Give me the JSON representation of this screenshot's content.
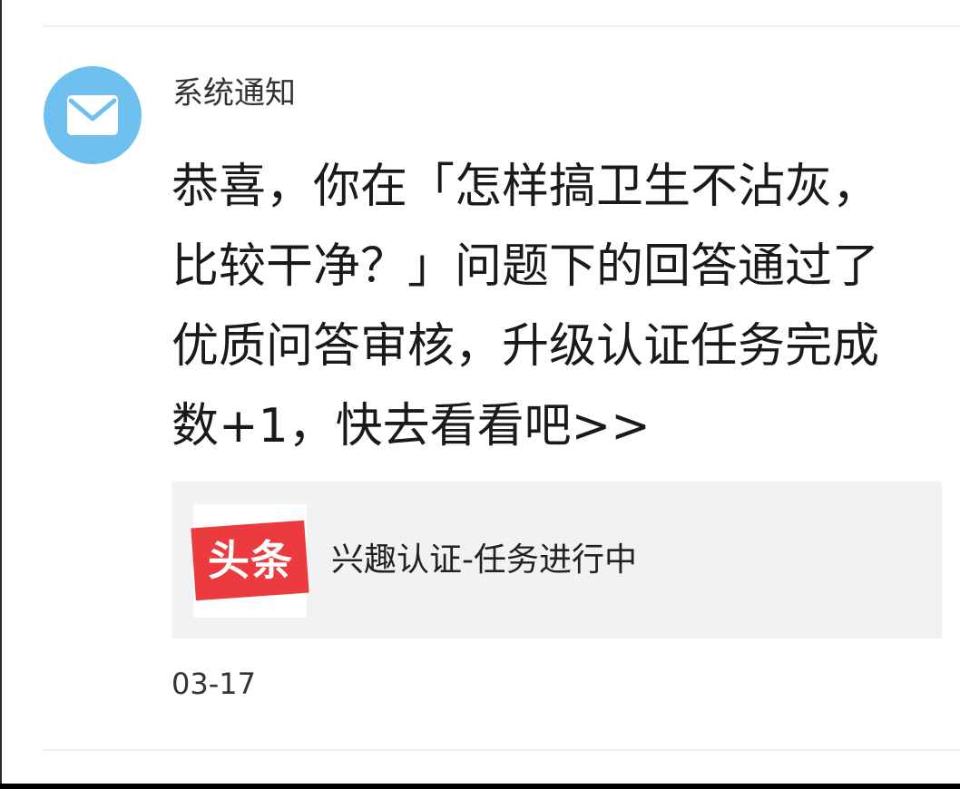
{
  "notification": {
    "sender": "系统通知",
    "avatar_icon": "mail-icon",
    "avatar_color": "#6ec1ef",
    "message": "恭喜，你在「怎样搞卫生不沾灰，比较干净？」问题下的回答通过了优质问答审核，升级认证任务完成数+1，快去看看吧>>",
    "card": {
      "logo_text": "头条",
      "logo_color": "#ec3b3f",
      "title": "兴趣认证-任务进行中"
    },
    "timestamp": "03-17"
  }
}
